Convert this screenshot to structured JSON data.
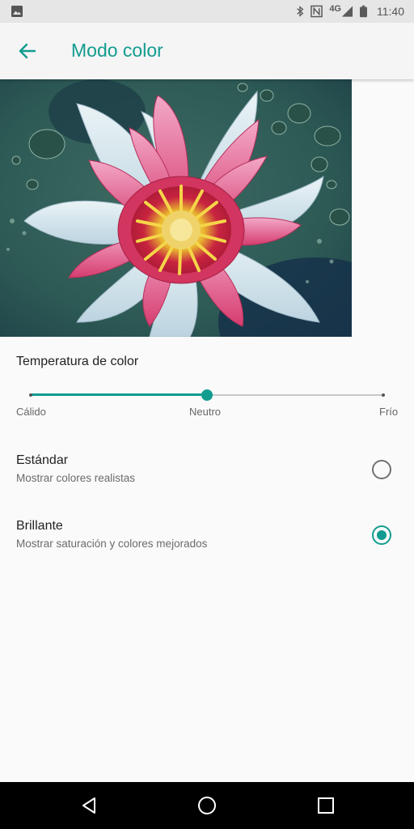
{
  "status_bar": {
    "time": "11:40",
    "network": "4G",
    "icons": [
      "gallery-notification-icon",
      "bluetooth-icon",
      "nfc-icon",
      "signal-icon",
      "battery-icon"
    ]
  },
  "app_bar": {
    "title": "Modo color",
    "back_icon": "arrow-left-icon"
  },
  "color_temperature": {
    "label": "Temperatura de color",
    "labels": {
      "warm": "Cálido",
      "neutral": "Neutro",
      "cool": "Frío"
    },
    "value_fraction": 0.5
  },
  "options": [
    {
      "title": "Estándar",
      "subtitle": "Mostrar colores realistas",
      "selected": false
    },
    {
      "title": "Brillante",
      "subtitle": "Mostrar saturación y colores mejorados",
      "selected": true
    }
  ],
  "colors": {
    "accent": "#129c8f",
    "navbar": "#000000"
  },
  "nav_bar": {
    "icons": [
      "back-triangle-icon",
      "home-circle-icon",
      "recents-square-icon"
    ]
  }
}
